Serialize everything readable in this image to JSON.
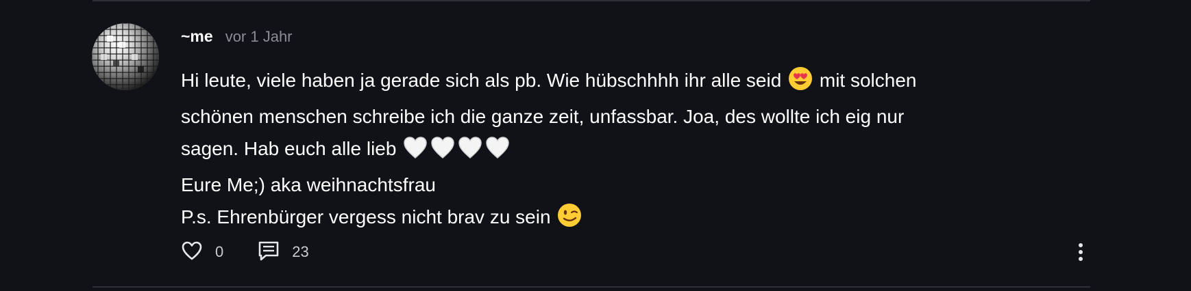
{
  "comment": {
    "author": "~me",
    "timestamp": "vor 1 Jahr",
    "lines": [
      {
        "text": "Hi leute, viele haben ja gerade sich als pb. Wie hübschhhh ihr alle seid",
        "after_emoji": "heart-eyes",
        "tail": "mit solchen"
      },
      {
        "text": "schönen menschen schreibe ich die ganze zeit, unfassbar. Joa, des wollte ich eig nur"
      },
      {
        "text": "sagen. Hab euch alle lieb",
        "after_emoji": "white-heart x4"
      },
      {
        "text": "Eure Me;) aka weihnachtsfrau"
      },
      {
        "text": "P.s. Ehrenbürger vergess nicht brav zu sein",
        "after_emoji": "winking-face"
      }
    ],
    "likes": "0",
    "replies": "23"
  },
  "icons": {
    "like": "heart-outline-icon",
    "reply": "comment-icon",
    "more": "vertical-dots-icon"
  },
  "colors": {
    "background": "#111218",
    "divider": "#2e3038",
    "text": "#ffffff",
    "muted": "#8b8d96"
  }
}
